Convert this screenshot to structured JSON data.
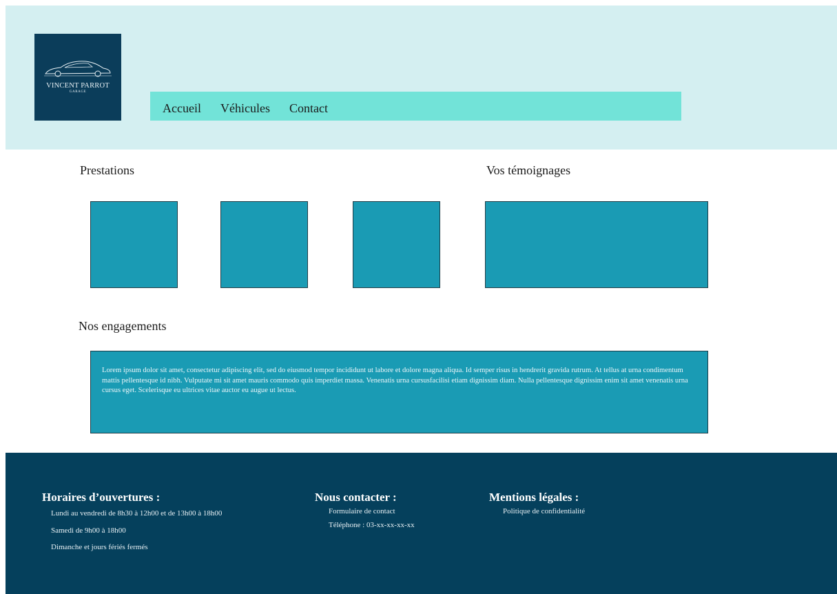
{
  "header": {
    "logo": {
      "brand": "VINCENT PARROT",
      "sub": "GARAGE",
      "icon": "car-icon"
    },
    "nav": [
      {
        "label": "Accueil"
      },
      {
        "label": "Véhicules"
      },
      {
        "label": "Contact"
      }
    ]
  },
  "main": {
    "prestations_title": "Prestations",
    "temoignages_title": "Vos témoignages",
    "engagements_title": "Nos engagements",
    "engagements_text": "Lorem ipsum dolor sit amet, consectetur adipiscing elit, sed do eiusmod tempor incididunt ut labore et dolore magna aliqua. Id semper risus in hendrerit gravida rutrum. At tellus at urna condimentum mattis pellentesque id nibh. Vulputate mi sit amet mauris commodo quis imperdiet massa. Venenatis urna cursusfacilisi etiam dignissim diam. Nulla pellentesque dignissim enim sit amet venenatis urna cursus eget. Scelerisque eu ultrices vitae auctor eu augue ut lectus."
  },
  "footer": {
    "horaires": {
      "title": "Horaires d’ouvertures :",
      "items": [
        "Lundi au vendredi de 8h30 à 12h00 et de 13h00 à 18h00",
        "Samedi de 9h00 à 18h00",
        "Dimanche et jours fériés fermés"
      ]
    },
    "contact": {
      "title": "Nous contacter :",
      "items": [
        "Formulaire de contact",
        "Téléphone : 03-xx-xx-xx-xx"
      ]
    },
    "mentions": {
      "title": "Mentions légales :",
      "items": [
        "Politique de confidentialité"
      ]
    }
  },
  "colors": {
    "header_bg": "#d4eff1",
    "nav_bg": "#72e3d8",
    "logo_bg": "#0b3d5a",
    "card_bg": "#1a9bb4",
    "footer_bg": "#05405c"
  }
}
